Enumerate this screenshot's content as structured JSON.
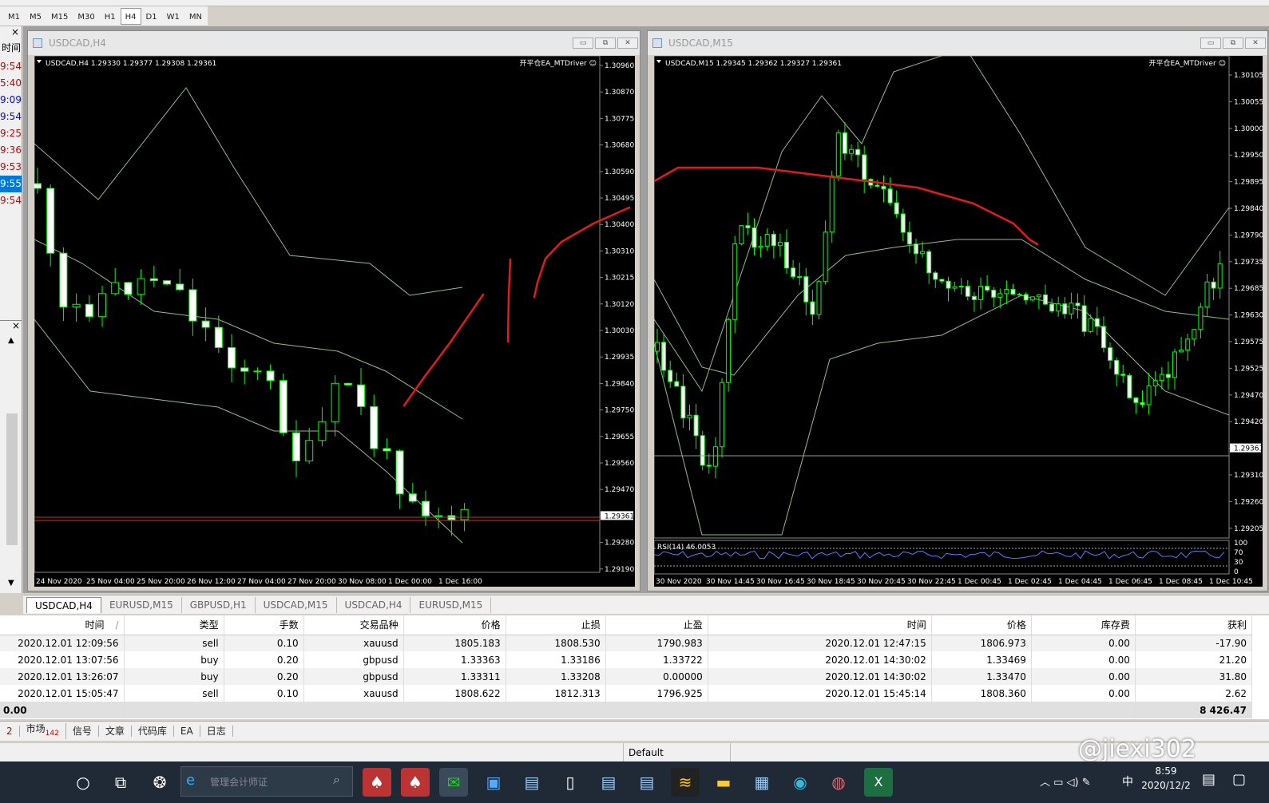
{
  "timeframes": [
    "M1",
    "M5",
    "M15",
    "M30",
    "H1",
    "H4",
    "D1",
    "W1",
    "MN"
  ],
  "selected_tf": "H4",
  "left_panel": {
    "close_x": "×",
    "times": [
      "9:54",
      "5:40",
      "9:09",
      "9:54",
      "9:25",
      "9:36",
      "9:53",
      "9:55",
      "9:54"
    ],
    "time_label": "时间",
    "close_x2": "×"
  },
  "win1": {
    "title": "USDCAD,H4",
    "info": "USDCAD,H4  1.29330 1.29377 1.29308 1.29361",
    "ea": "开平仓EA_MTDriver ☺",
    "prices": [
      "1.30960",
      "1.30870",
      "1.30775",
      "1.30680",
      "1.30590",
      "1.30495",
      "1.30400",
      "1.30310",
      "1.30215",
      "1.30120",
      "1.30030",
      "1.29935",
      "1.29840",
      "1.29750",
      "1.29655",
      "1.29560",
      "1.29470",
      "1.29361",
      "1.29280",
      "1.29190"
    ],
    "times": [
      "24 Nov 2020",
      "25 Nov 04:00",
      "25 Nov 20:00",
      "26 Nov 12:00",
      "27 Nov 04:00",
      "27 Nov 20:00",
      "30 Nov 08:00",
      "1 Dec 00:00",
      "1 Dec 16:00"
    ]
  },
  "win2": {
    "title": "USDCAD,M15",
    "info": "USDCAD,M15  1.29345 1.29362 1.29327 1.29361",
    "ea": "开平仓EA_MTDriver ☺",
    "prices": [
      "1.30105",
      "1.30055",
      "1.30000",
      "1.29950",
      "1.29895",
      "1.29840",
      "1.29790",
      "1.29735",
      "1.29685",
      "1.29630",
      "1.29575",
      "1.29525",
      "1.29470",
      "1.29420",
      "1.29361",
      "1.29310",
      "1.29260",
      "1.29205"
    ],
    "rsi_label": "RSI(14) 46.0053",
    "rsi_levels": [
      "100",
      "70",
      "30",
      "0"
    ],
    "times": [
      "30 Nov 2020",
      "30 Nov 14:45",
      "30 Nov 16:45",
      "30 Nov 18:45",
      "30 Nov 20:45",
      "30 Nov 22:45",
      "1 Dec 00:45",
      "1 Dec 02:45",
      "1 Dec 04:45",
      "1 Dec 06:45",
      "1 Dec 08:45",
      "1 Dec 10:45"
    ]
  },
  "chart_tabs": [
    "USDCAD,H4",
    "EURUSD,M15",
    "GBPUSD,H1",
    "USDCAD,M15",
    "USDCAD,H4",
    "EURUSD,M15"
  ],
  "table": {
    "headers": [
      "时间",
      "类型",
      "手数",
      "交易品种",
      "价格",
      "止损",
      "止盈",
      "时间",
      "价格",
      "库存费",
      "获利"
    ],
    "sort_mark": "/",
    "rows": [
      [
        "2020.12.01 12:09:56",
        "sell",
        "0.10",
        "xauusd",
        "1805.183",
        "1808.530",
        "1790.983",
        "2020.12.01 12:47:15",
        "1806.973",
        "0.00",
        "-17.90"
      ],
      [
        "2020.12.01 13:07:56",
        "buy",
        "0.20",
        "gbpusd",
        "1.33363",
        "1.33186",
        "1.33722",
        "2020.12.01 14:30:02",
        "1.33469",
        "0.00",
        "21.20"
      ],
      [
        "2020.12.01 13:26:07",
        "buy",
        "0.20",
        "gbpusd",
        "1.33311",
        "1.33208",
        "0.00000",
        "2020.12.01 14:30:02",
        "1.33470",
        "0.00",
        "31.80"
      ],
      [
        "2020.12.01 15:05:47",
        "sell",
        "0.10",
        "xauusd",
        "1808.622",
        "1812.313",
        "1796.925",
        "2020.12.01 15:45:14",
        "1808.360",
        "0.00",
        "2.62"
      ]
    ],
    "total_left": "0.00",
    "total_right": "8 426.47"
  },
  "bottom_tabs": [
    "2",
    "市场",
    "信号",
    "文章",
    "代码库",
    "EA",
    "日志"
  ],
  "market_count": "142",
  "status_profile": "Default",
  "watermark": "@jiexi302",
  "taskbar": {
    "search_placeholder": "管理会计师证",
    "time": "8:59",
    "date": "2020/12/2",
    "ime": "中"
  }
}
